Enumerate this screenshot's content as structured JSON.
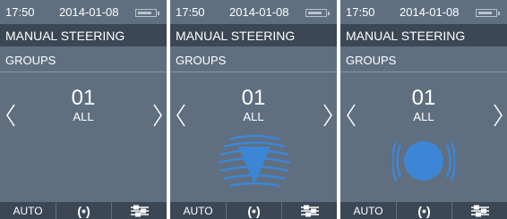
{
  "screens": [
    {
      "status": {
        "time": "17:50",
        "date": "2014-01-08"
      },
      "title": "MANUAL STEERING",
      "section": "GROUPS",
      "group": {
        "number": "01",
        "name": "ALL"
      },
      "state_icon": null,
      "bottom": {
        "auto_label": "AUTO",
        "target_symbol": "(•)",
        "settings_icon": "sliders-icon"
      }
    },
    {
      "status": {
        "time": "17:50",
        "date": "2014-01-08"
      },
      "title": "MANUAL STEERING",
      "section": "GROUPS",
      "group": {
        "number": "01",
        "name": "ALL"
      },
      "state_icon": "steer-down-icon",
      "bottom": {
        "auto_label": "AUTO",
        "target_symbol": "(•)",
        "settings_icon": "sliders-icon"
      }
    },
    {
      "status": {
        "time": "17:50",
        "date": "2014-01-08"
      },
      "title": "MANUAL STEERING",
      "section": "GROUPS",
      "group": {
        "number": "01",
        "name": "ALL"
      },
      "state_icon": "center-target-icon",
      "bottom": {
        "auto_label": "AUTO",
        "target_symbol": "(•)",
        "settings_icon": "sliders-icon"
      }
    }
  ],
  "colors": {
    "screen_bg": "#5f6f80",
    "bar_bg": "#3b4755",
    "accent": "#3d86d6"
  },
  "battery_level": 0.75
}
